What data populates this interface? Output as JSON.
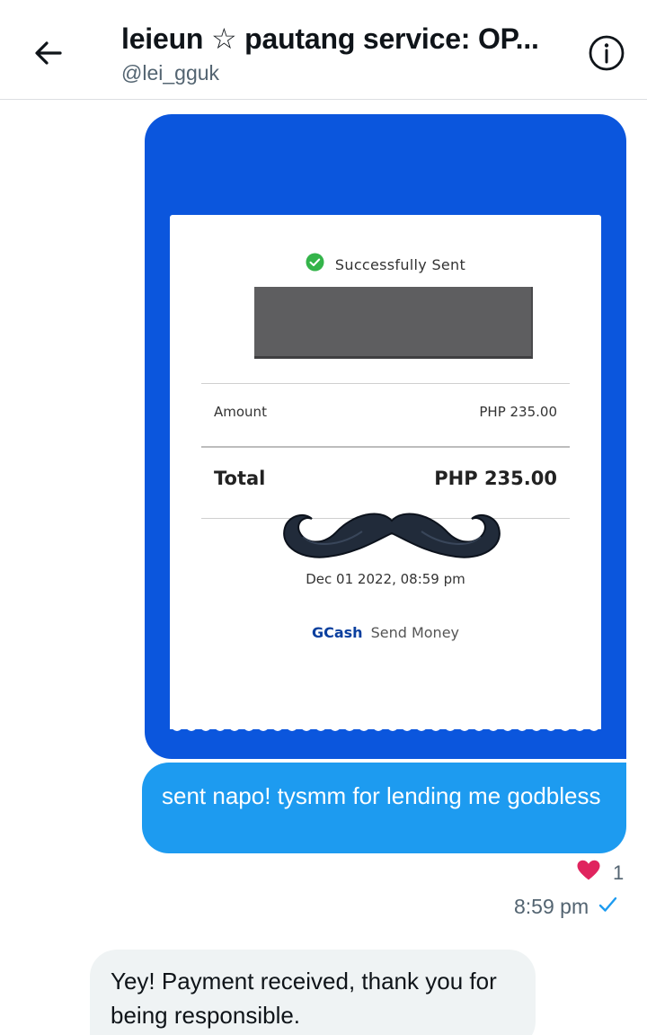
{
  "header": {
    "title": "leieun ☆ pautang service: OP...",
    "handle": "@lei_gguk",
    "back_icon": "arrow-left-icon",
    "info_icon": "info-icon"
  },
  "image_message": {
    "receipt": {
      "status": "Successfully Sent",
      "amount_label": "Amount",
      "amount_value": "PHP 235.00",
      "total_label": "Total",
      "total_value": "PHP 235.00",
      "date": "Dec 01 2022, 08:59 pm",
      "brand": "GCash",
      "brand_sub": "Send Money"
    }
  },
  "sent_message": {
    "text": "sent napo! tysmm for lending me godbless",
    "reaction_icon": "heart-icon",
    "reaction_count": "1",
    "time": "8:59 pm",
    "status_icon": "check-icon"
  },
  "received_message": {
    "text": "Yey! Payment received, thank you for being responsible."
  },
  "colors": {
    "accent": "#1d9bf0",
    "image_bg": "#0b56dd",
    "received_bg": "#eff3f4",
    "heart": "#e0245e"
  }
}
